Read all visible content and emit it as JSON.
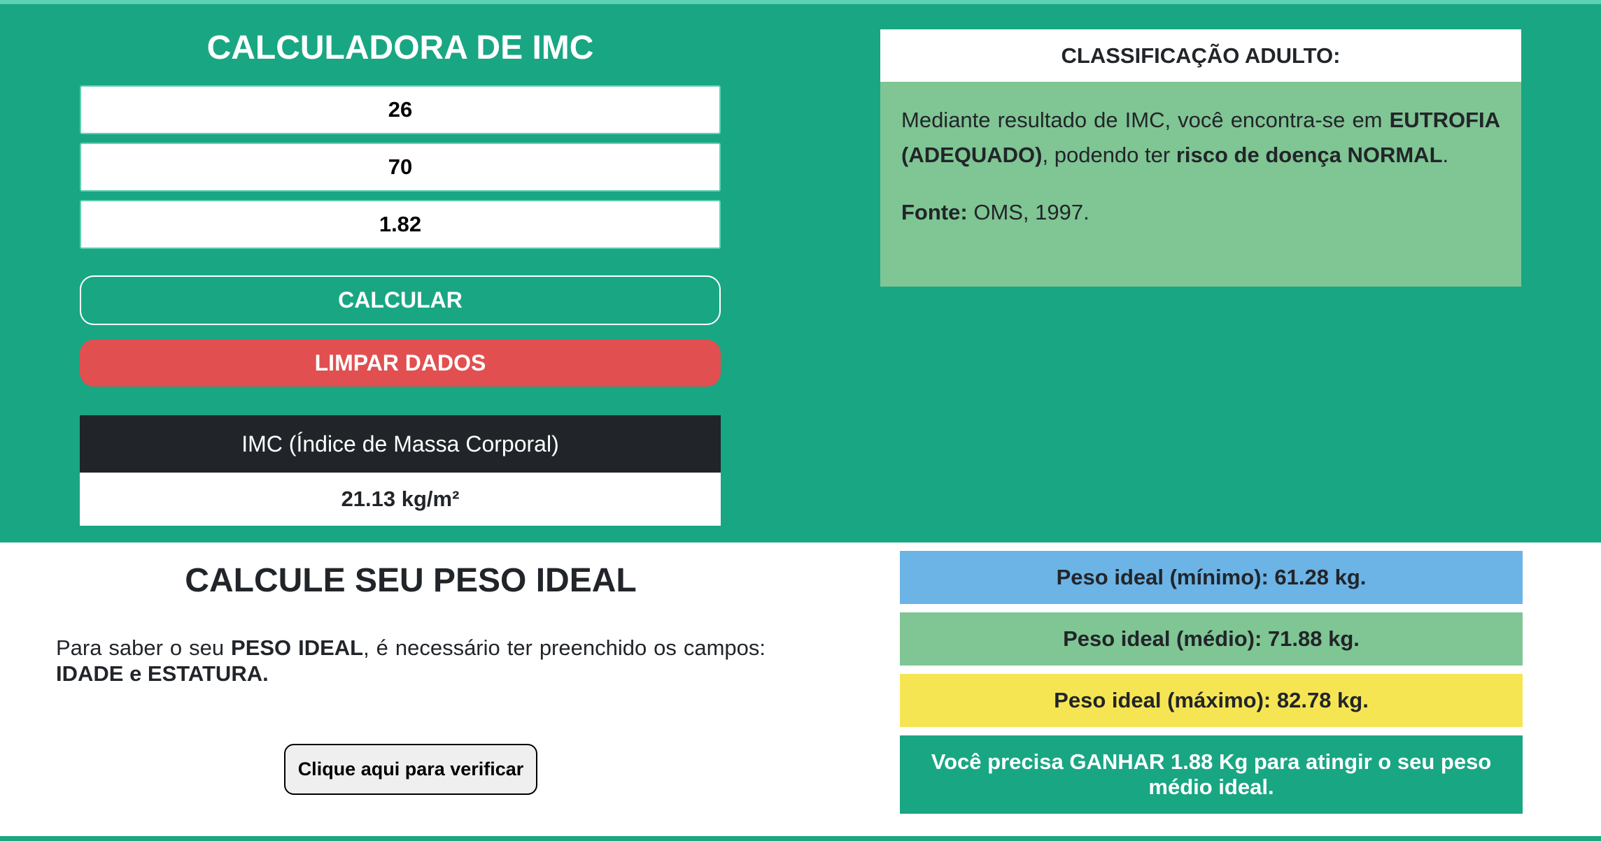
{
  "calculator": {
    "title": "CALCULADORA DE IMC",
    "age_value": "26",
    "weight_value": "70",
    "height_value": "1.82",
    "calculate_label": "CALCULAR",
    "clear_label": "LIMPAR DADOS"
  },
  "result": {
    "header": "IMC (Índice de Massa Corporal)",
    "value": "21.13 kg/m²"
  },
  "classification": {
    "header": "CLASSIFICAÇÃO ADULTO:",
    "text_pre": "Mediante resultado de IMC, você encontra-se em ",
    "status": "EUTROFIA (ADEQUADO)",
    "text_mid": ", podendo ter ",
    "risk_label": "risco de doença NORMAL",
    "text_end": ".",
    "source_label": "Fonte:",
    "source_value": " OMS, 1997."
  },
  "ideal_weight": {
    "title": "CALCULE SEU PESO IDEAL",
    "text_pre": "Para saber o seu ",
    "text_bold1": "PESO IDEAL",
    "text_mid": ", é necessário ter preenchido os campos: ",
    "text_bold2": "IDADE e ESTATURA.",
    "verify_label": "Clique aqui para verificar",
    "min": "Peso ideal (mínimo): 61.28 kg.",
    "med": "Peso ideal (médio): 71.88 kg.",
    "max": "Peso ideal (máximo): 82.78 kg.",
    "message": "Você precisa GANHAR 1.88 Kg para atingir o seu peso médio ideal."
  },
  "colors": {
    "primary_green": "#19a683",
    "danger_red": "#e14f51",
    "dark": "#212529",
    "light_green": "#80c594",
    "blue": "#6cb3e6",
    "yellow": "#f6e553"
  }
}
